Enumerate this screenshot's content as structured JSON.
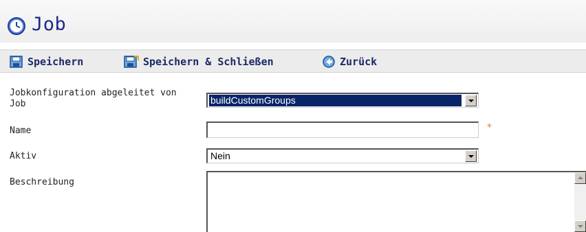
{
  "page": {
    "title": "Job",
    "title_icon": "clock-icon"
  },
  "toolbar": {
    "save_label": "Speichern",
    "save_close_label": "Speichern & Schließen",
    "back_label": "Zurück"
  },
  "form": {
    "job_config": {
      "label": "Jobkonfiguration abgeleitet von Job",
      "value": "buildCustomGroups"
    },
    "name": {
      "label": "Name",
      "value": "",
      "required_marker": "*"
    },
    "active": {
      "label": "Aktiv",
      "value": "Nein"
    },
    "description": {
      "label": "Beschreibung",
      "value": ""
    }
  },
  "colors": {
    "title_text": "#1d2b8c",
    "toolbar_bg": "#ececec",
    "selection_bg": "#0a246a",
    "required": "#f07820"
  }
}
